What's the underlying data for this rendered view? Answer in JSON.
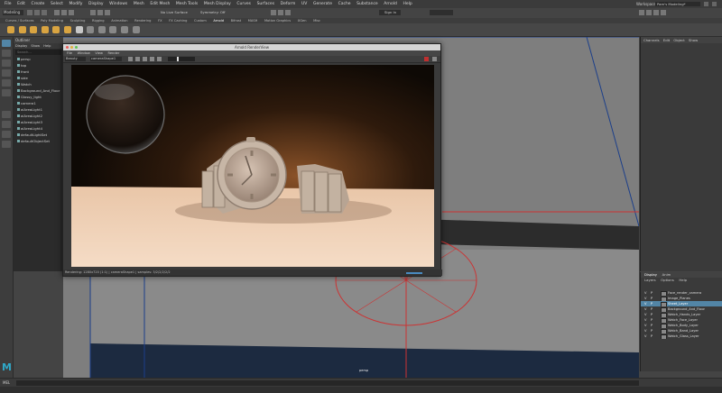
{
  "menubar": {
    "items": [
      "File",
      "Edit",
      "Create",
      "Select",
      "Modify",
      "Display",
      "Windows",
      "Mesh",
      "Edit Mesh",
      "Mesh Tools",
      "Mesh Display",
      "Curves",
      "Surfaces",
      "Deform",
      "UV",
      "Generate",
      "Cache",
      "Substance",
      "Arnold",
      "Help"
    ],
    "workspace_label": "Workspace:",
    "workspace_value": "Pam's Modeling*"
  },
  "statusline": {
    "mode": "Modeling",
    "live_surface": "No Live Surface",
    "symmetry": "Symmetry: Off",
    "sign_in": "Sign In"
  },
  "shelf": {
    "tabs": [
      "Curves / Surfaces",
      "Poly Modeling",
      "Sculpting",
      "Rigging",
      "Animation",
      "Rendering",
      "FX",
      "FX Caching",
      "Custom",
      "Arnold",
      "Bifrost",
      "MASH",
      "Motion Graphics",
      "XGen",
      "Misc"
    ],
    "active_tab": "Arnold"
  },
  "outliner": {
    "title": "Outliner",
    "menu": [
      "Display",
      "Show",
      "Help"
    ],
    "search_placeholder": "Search...",
    "items": [
      "persp",
      "top",
      "front",
      "side",
      "Watch",
      "Background_And_Floor",
      "Glossy_light",
      "camera1",
      "aiAreaLight1",
      "aiAreaLight2",
      "aiAreaLight3",
      "aiAreaLight4",
      "defaultLightSet",
      "defaultObjectSet"
    ]
  },
  "render_view": {
    "title": "Arnold RenderView",
    "menu": [
      "File",
      "Window",
      "View",
      "Render"
    ],
    "display_mode": "Beauty",
    "camera": "cameraShape1",
    "status": "Rendering: 1280x720 (1:1) | cameraShape1 | samples: 3/2/2/2/2/2"
  },
  "viewport": {
    "camera_label": "persp"
  },
  "channel_box": {
    "menu": [
      "Channels",
      "Edit",
      "Object",
      "Show"
    ]
  },
  "layer_editor": {
    "tabs": [
      "Display",
      "Anim"
    ],
    "menu": [
      "Layers",
      "Options",
      "Help"
    ],
    "layers": [
      {
        "v": "V",
        "p": "P",
        "name": "Face_render_camera",
        "selected": false
      },
      {
        "v": "V",
        "p": "P",
        "name": "Image_Planes",
        "selected": false
      },
      {
        "v": "V",
        "p": "P",
        "name": "Sheet_Layer",
        "selected": true
      },
      {
        "v": "V",
        "p": "P",
        "name": "Background_And_Floor",
        "selected": false
      },
      {
        "v": "V",
        "p": "P",
        "name": "Watch_Hands_Layer",
        "selected": false
      },
      {
        "v": "V",
        "p": "P",
        "name": "Watch_Face_Layer",
        "selected": false
      },
      {
        "v": "V",
        "p": "P",
        "name": "Watch_Body_Layer",
        "selected": false
      },
      {
        "v": "V",
        "p": "P",
        "name": "Watch_Band_Layer",
        "selected": false
      },
      {
        "v": "V",
        "p": "P",
        "name": "Watch_Glass_Layer",
        "selected": false
      }
    ]
  },
  "cmdline": {
    "label": "MEL"
  },
  "colors": {
    "accent": "#5285a6",
    "brand": "#2fa8c8"
  }
}
